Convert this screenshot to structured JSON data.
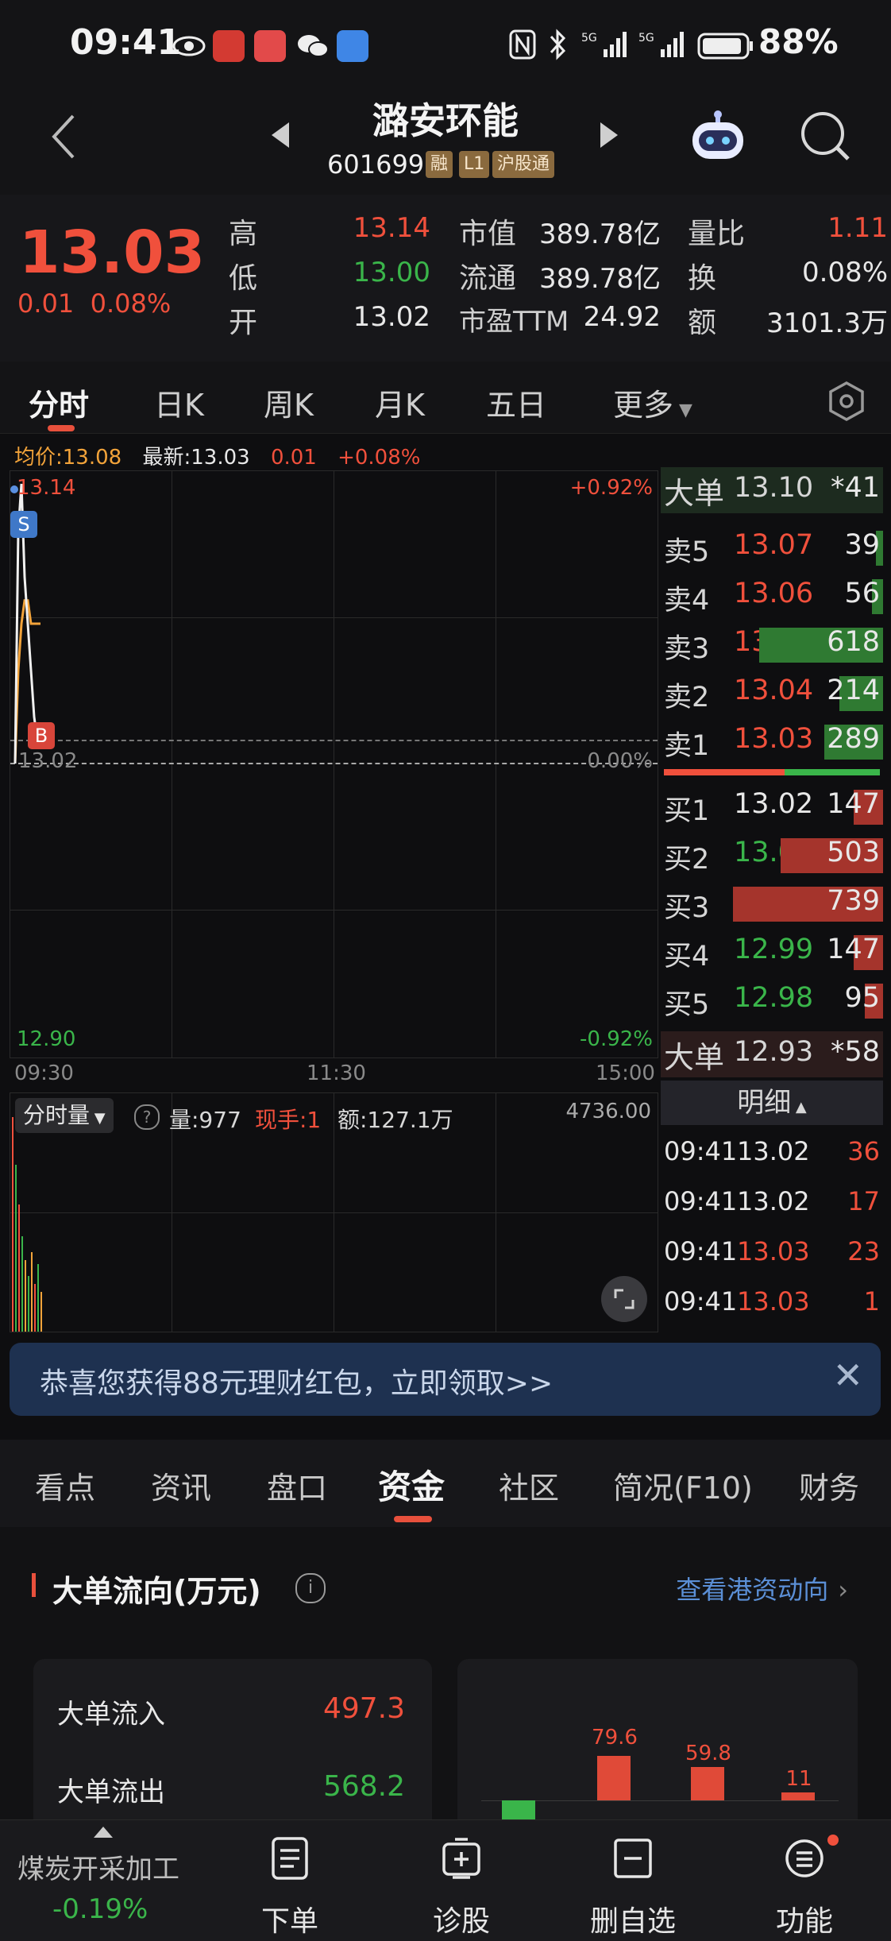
{
  "status_bar": {
    "time": "09:41",
    "battery": "88%"
  },
  "header": {
    "title": "潞安环能",
    "code": "601699",
    "tags": [
      "融",
      "L1",
      "沪股通"
    ]
  },
  "quote": {
    "price": "13.03",
    "change": "0.01",
    "change_pct": "0.08%",
    "high_label": "高",
    "high": "13.14",
    "low_label": "低",
    "low": "13.00",
    "open_label": "开",
    "open": "13.02",
    "mcap_label": "市值",
    "mcap": "389.78亿",
    "float_label": "流通",
    "float": "389.78亿",
    "pe_label": "市盈TTM",
    "pe": "24.92",
    "vr_label": "量比",
    "vr": "1.11",
    "turn_label": "换",
    "turn": "0.08%",
    "amt_label": "额",
    "amt": "3101.3万"
  },
  "chart_tabs": [
    "分时",
    "日K",
    "周K",
    "月K",
    "五日",
    "更多"
  ],
  "chart_info": {
    "avg": "均价:13.08",
    "latest": "最新:13.03",
    "chg": "0.01",
    "pct": "+0.08%"
  },
  "chart_data": {
    "type": "line",
    "price_max": "13.14",
    "price_ref": "13.02",
    "price_min": "12.90",
    "pct_max": "+0.92%",
    "pct_ref": "0.00%",
    "pct_min": "-0.92%",
    "time_ticks": [
      "09:30",
      "11:30",
      "15:00"
    ],
    "ylim": [
      12.9,
      13.14
    ],
    "series": [
      {
        "values": [
          13.02,
          13.12,
          13.14,
          13.1,
          13.08,
          13.06,
          13.04,
          13.03,
          13.03
        ]
      },
      {
        "values": [
          13.02,
          13.06,
          13.08,
          13.09,
          13.09,
          13.08,
          13.08,
          13.08,
          13.08
        ]
      }
    ],
    "markers": [
      "S",
      "B"
    ]
  },
  "volume": {
    "selector": "分时量",
    "vol": "量:977",
    "hand": "现手:1",
    "amount": "额:127.1万",
    "max": "4736.00"
  },
  "order_book": {
    "big_sell": {
      "label": "大单",
      "price": "13.10",
      "qty": "*41"
    },
    "asks": [
      {
        "label": "卖5",
        "price": "13.07",
        "qty": "39",
        "bar": 0.04
      },
      {
        "label": "卖4",
        "price": "13.06",
        "qty": "56",
        "bar": 0.06
      },
      {
        "label": "卖3",
        "price": "13.05",
        "qty": "618",
        "bar": 0.68
      },
      {
        "label": "卖2",
        "price": "13.04",
        "qty": "214",
        "bar": 0.24
      },
      {
        "label": "卖1",
        "price": "13.03",
        "qty": "289",
        "bar": 0.32
      }
    ],
    "bids": [
      {
        "label": "买1",
        "price": "13.02",
        "qty": "147",
        "bar": 0.16
      },
      {
        "label": "买2",
        "price": "13.01",
        "qty": "503",
        "bar": 0.56
      },
      {
        "label": "买3",
        "price": "13.00",
        "qty": "739",
        "bar": 0.82
      },
      {
        "label": "买4",
        "price": "12.99",
        "qty": "147",
        "bar": 0.16
      },
      {
        "label": "买5",
        "price": "12.98",
        "qty": "95",
        "bar": 0.1
      }
    ],
    "big_buy": {
      "label": "大单",
      "price": "12.93",
      "qty": "*58"
    },
    "detail_label": "明细",
    "trades": [
      {
        "time": "09:41",
        "price": "13.02",
        "qty": "36"
      },
      {
        "time": "09:41",
        "price": "13.02",
        "qty": "17"
      },
      {
        "time": "09:41",
        "price": "13.03",
        "qty": "23"
      },
      {
        "time": "09:41",
        "price": "13.03",
        "qty": "1"
      }
    ]
  },
  "banner": {
    "text": "恭喜您获得88元理财红包，立即领取>>"
  },
  "lower_tabs": [
    "看点",
    "资讯",
    "盘口",
    "资金",
    "社区",
    "简况(F10)",
    "财务"
  ],
  "fund_flow": {
    "title": "大单流向(万元)",
    "link": "查看港资动向",
    "inflow_label": "大单流入",
    "inflow": "497.3",
    "outflow_label": "大单流出",
    "outflow": "568.2",
    "bar_values": [
      "79.6",
      "59.8",
      "11"
    ]
  },
  "bottom_nav": {
    "sector": "煤炭开采加工",
    "sector_pct": "-0.19%",
    "items": [
      "下单",
      "诊股",
      "删自选",
      "功能"
    ]
  },
  "colors": {
    "up": "#f0503c",
    "down": "#3ab54a",
    "accent": "#e8503c",
    "link": "#5b8fd6"
  }
}
